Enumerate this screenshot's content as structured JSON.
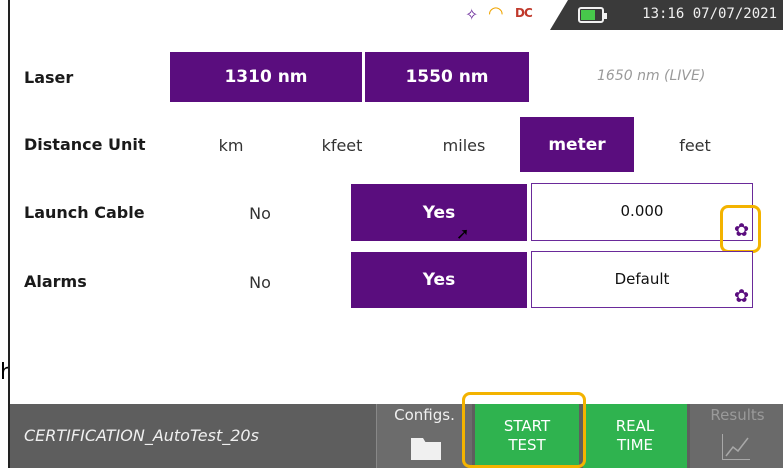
{
  "status": {
    "clock": "13:16 07/07/2021",
    "icons": [
      "wand-icon",
      "wifi-icon",
      "dc-icon",
      "battery-icon"
    ],
    "dc_text": "DC"
  },
  "laser": {
    "label": "Laser",
    "options": [
      "1310 nm",
      "1550 nm"
    ],
    "live": "1650 nm (LIVE)"
  },
  "distance_unit": {
    "label": "Distance Unit",
    "options": [
      "km",
      "kfeet",
      "miles",
      "meter",
      "feet"
    ],
    "selected": "meter"
  },
  "launch_cable": {
    "label": "Launch Cable",
    "no": "No",
    "yes": "Yes",
    "value": "0.000"
  },
  "alarms": {
    "label": "Alarms",
    "no": "No",
    "yes": "Yes",
    "value": "Default"
  },
  "bottom": {
    "profile": "CERTIFICATION_AutoTest_20s",
    "configs": "Configs.",
    "start_line1": "START",
    "start_line2": "TEST",
    "real_line1": "REAL",
    "real_line2": "TIME",
    "results": "Results"
  },
  "colors": {
    "accent_purple": "#5a0d7e",
    "green": "#2fb34f",
    "highlight": "#f3b300"
  },
  "edge_char": "h"
}
